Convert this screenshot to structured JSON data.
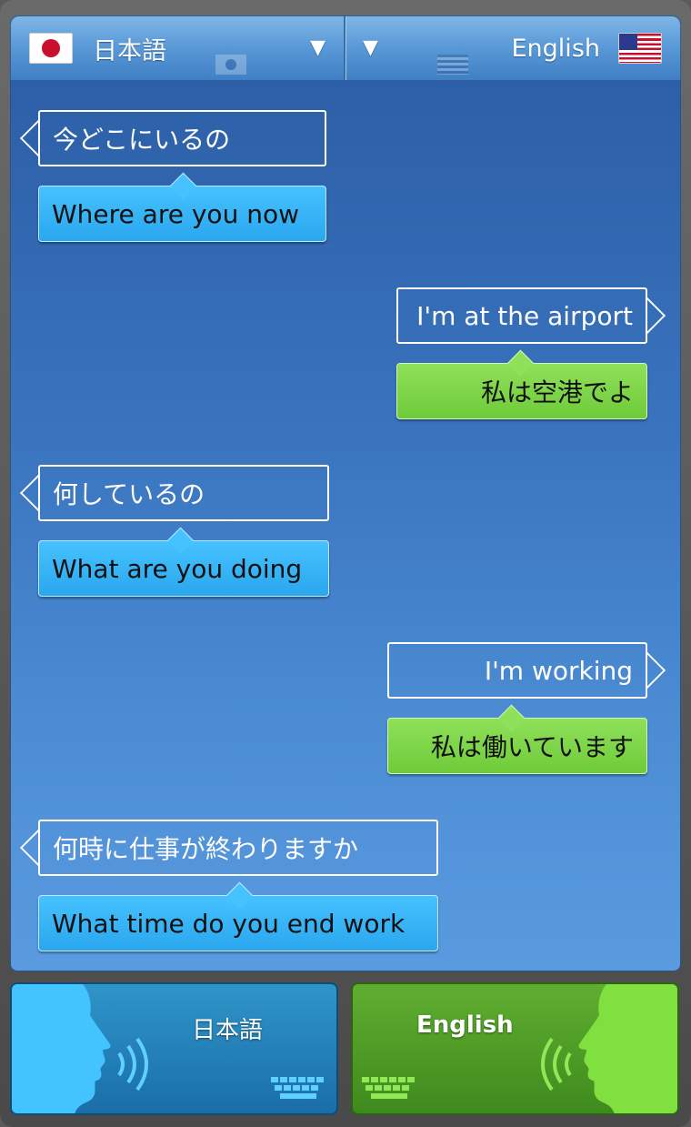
{
  "header": {
    "source_lang": "日本語",
    "target_lang": "English",
    "source_flag_icon": "japan-flag-icon",
    "target_flag_icon": "us-flag-icon",
    "caret_icon": "triangle-down-icon"
  },
  "conversation": [
    {
      "side": "left",
      "source": "今どこにいるの",
      "translation": "Where are you now"
    },
    {
      "side": "right",
      "source": "I'm at the airport",
      "translation": "私は空港でよ"
    },
    {
      "side": "left",
      "source": "何しているの",
      "translation": "What are you doing"
    },
    {
      "side": "right",
      "source": "I'm working",
      "translation": "私は働いています"
    },
    {
      "side": "left",
      "source": "何時に仕事が終わりますか",
      "translation": "What time do you end work"
    }
  ],
  "buttons": {
    "japanese_label": "日本語",
    "english_label": "English"
  },
  "colors": {
    "panel_blue": "#3a74bf",
    "bubble_blue": "#2aa7ee",
    "bubble_green": "#6ecb38",
    "button_blue": "#1a6ea8",
    "button_green": "#3f8a1e"
  }
}
